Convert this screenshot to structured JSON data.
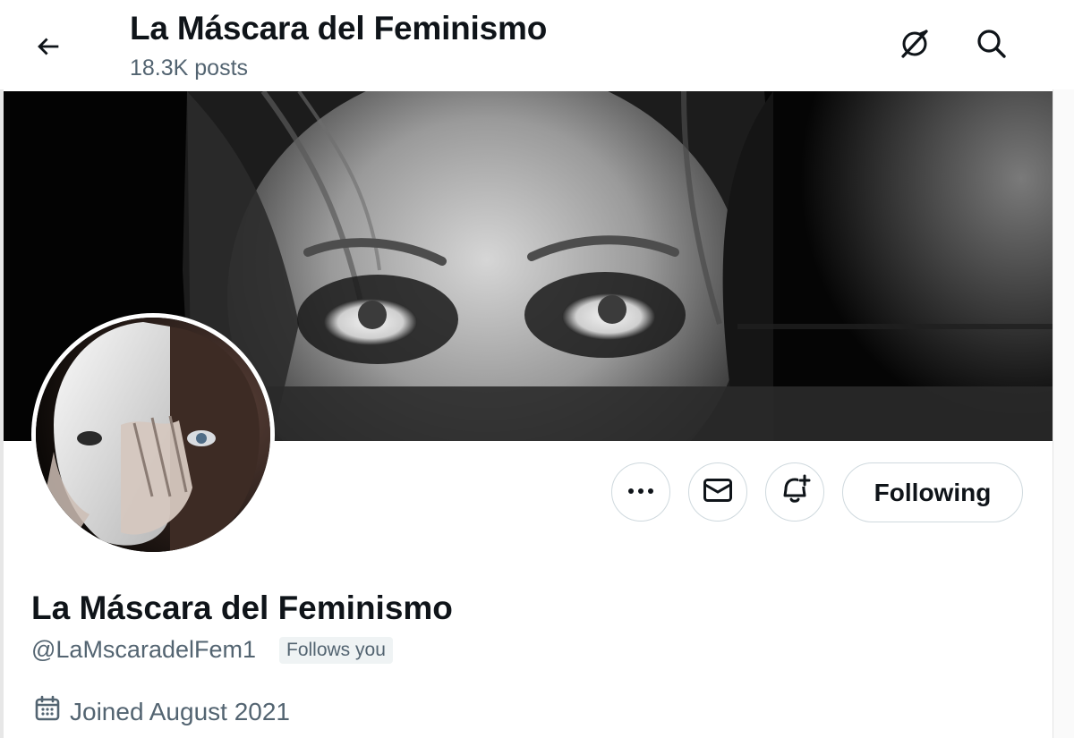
{
  "header": {
    "title": "La Máscara del Feminismo",
    "post_count": "18.3K posts",
    "icons": [
      "back-arrow-icon",
      "grok-icon",
      "search-icon"
    ]
  },
  "profile": {
    "display_name": "La Máscara del Feminismo",
    "handle": "@LaMscaradelFem1",
    "follows_you_badge": "Follows you",
    "joined": "Joined August 2021"
  },
  "actions": {
    "more_icon": "more-icon",
    "message_icon": "envelope-icon",
    "notify_icon": "bell-plus-icon",
    "following_label": "Following"
  },
  "colors": {
    "text_primary": "#0f1419",
    "text_secondary": "#536471",
    "border": "#cfd9de",
    "badge_bg": "#eff3f4"
  }
}
